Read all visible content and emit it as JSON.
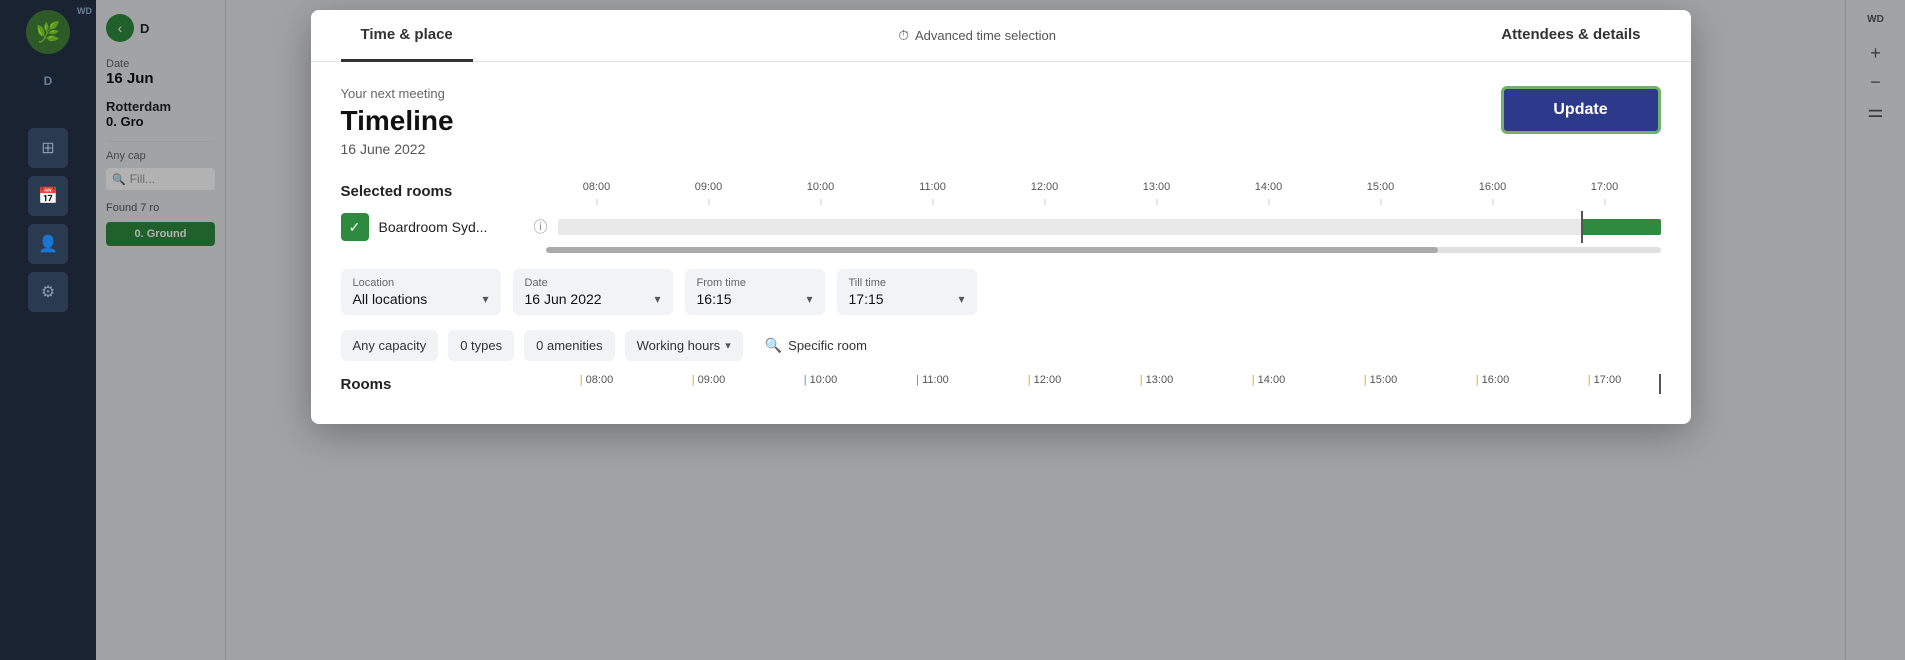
{
  "app": {
    "sidebar": {
      "logo_icon": "🌿",
      "initials": "D",
      "nav_items": [
        "grid",
        "calendar",
        "people",
        "settings"
      ]
    }
  },
  "left_panel": {
    "date_label": "Date",
    "date_value": "16 Jun",
    "location_label": "Rotterdam",
    "floor_label": "0. Gro",
    "capacity_label": "Any cap",
    "filter_placeholder": "Fill..."
  },
  "modal": {
    "tabs": {
      "time_place": "Time & place",
      "advanced_time": "Advanced time selection",
      "attendees": "Attendees & details"
    },
    "header": {
      "subtitle": "Your next meeting",
      "title": "Timeline",
      "date": "16 June 2022"
    },
    "update_button": "Update",
    "selected_rooms_label": "Selected rooms",
    "timeline_hours": [
      "08:00",
      "09:00",
      "10:00",
      "11:00",
      "12:00",
      "13:00",
      "14:00",
      "15:00",
      "16:00",
      "17:00"
    ],
    "rooms": [
      {
        "name": "Boardroom Syd...",
        "checked": true,
        "booking_start_pct": 95,
        "booking_width_pct": 6
      }
    ],
    "filters": {
      "location": {
        "label": "Location",
        "value": "All locations"
      },
      "date": {
        "label": "Date",
        "value": "16 Jun 2022"
      },
      "from_time": {
        "label": "From time",
        "value": "16:15"
      },
      "till_time": {
        "label": "Till time",
        "value": "17:15"
      },
      "capacity": "Any capacity",
      "types": "0 types",
      "amenities": "0 amenities",
      "hours": "Working hours",
      "specific_room": "Specific room"
    },
    "rooms_section": {
      "label": "Rooms",
      "hours": [
        "08:00",
        "09:00",
        "10:00",
        "11:00",
        "12:00",
        "13:00",
        "14:00",
        "15:00",
        "16:00",
        "17:00"
      ],
      "found_label": "Found 7 ro"
    }
  }
}
